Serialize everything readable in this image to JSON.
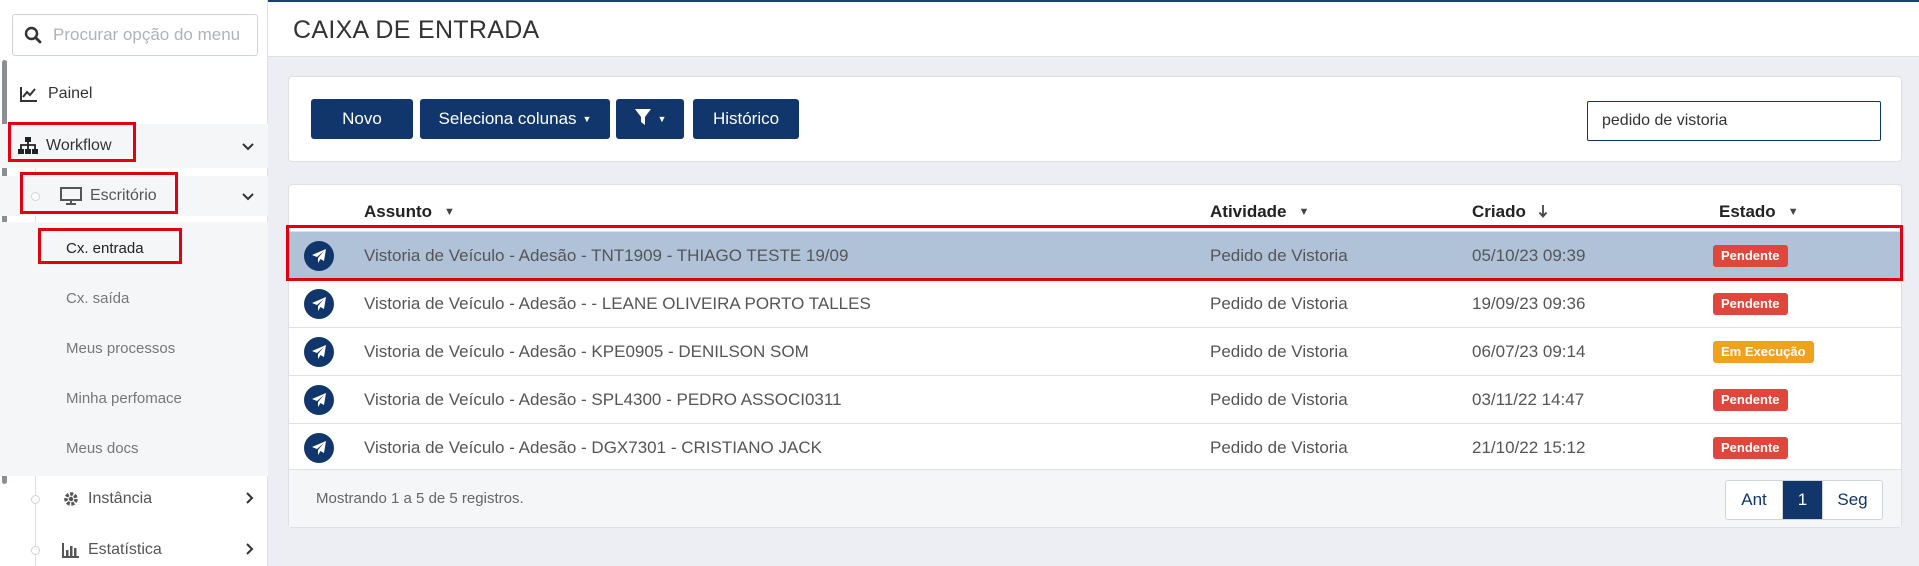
{
  "sidebar": {
    "search_placeholder": "Procurar opção do menu",
    "painel": "Painel",
    "workflow": "Workflow",
    "escritorio": "Escritório",
    "submenu": [
      "Cx. entrada",
      "Cx. saída",
      "Meus processos",
      "Minha perfomace",
      "Meus docs"
    ],
    "instancia": "Instância",
    "estatistica": "Estatística"
  },
  "header": {
    "title": "CAIXA DE ENTRADA"
  },
  "toolbar": {
    "novo": "Novo",
    "colunas": "Seleciona colunas",
    "historico": "Histórico",
    "search_value": "pedido de vistoria"
  },
  "table": {
    "headers": {
      "assunto": "Assunto",
      "atividade": "Atividade",
      "criado": "Criado",
      "estado": "Estado"
    },
    "rows": [
      {
        "assunto": "Vistoria de Veículo - Adesão - TNT1909 - THIAGO TESTE 19/09",
        "atividade": "Pedido de Vistoria",
        "criado": "05/10/23 09:39",
        "estado": "Pendente"
      },
      {
        "assunto": "Vistoria de Veículo - Adesão -  - LEANE OLIVEIRA PORTO TALLES",
        "atividade": "Pedido de Vistoria",
        "criado": "19/09/23 09:36",
        "estado": "Pendente"
      },
      {
        "assunto": "Vistoria de Veículo - Adesão - KPE0905 - DENILSON SOM",
        "atividade": "Pedido de Vistoria",
        "criado": "06/07/23 09:14",
        "estado": "Em Execução"
      },
      {
        "assunto": "Vistoria de Veículo - Adesão - SPL4300 - PEDRO ASSOCI0311",
        "atividade": "Pedido de Vistoria",
        "criado": "03/11/22 14:47",
        "estado": "Pendente"
      },
      {
        "assunto": "Vistoria de Veículo - Adesão - DGX7301 - CRISTIANO JACK",
        "atividade": "Pedido de Vistoria",
        "criado": "21/10/22 15:12",
        "estado": "Pendente"
      }
    ],
    "footer_info": "Mostrando 1 a 5 de 5 registros.",
    "pager": {
      "prev": "Ant",
      "current": "1",
      "next": "Seg"
    }
  },
  "colors": {
    "primary": "#11366b",
    "pendente": "#e0463c",
    "em_execucao": "#f0a21e",
    "selected_row": "#b0c2d8",
    "highlight": "#e3000f"
  }
}
